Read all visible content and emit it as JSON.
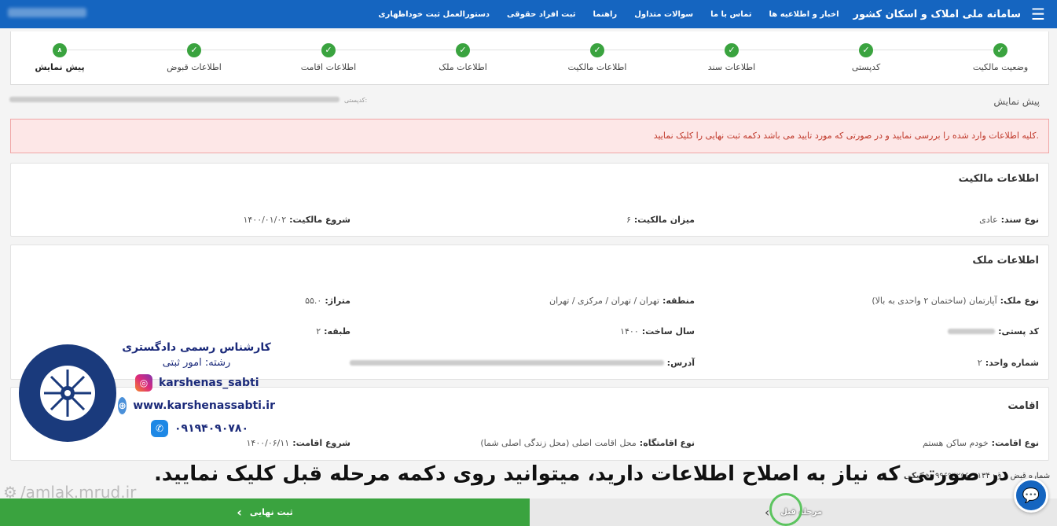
{
  "topbar": {
    "brand": "سامانه ملی املاک و اسکان کشور",
    "nav": [
      "اخبار و اطلاعیه ها",
      "تماس با ما",
      "سوالات متداول",
      "راهنما",
      "ثبت افراد حقوقی",
      "دستورالعمل ثبت خوداظهاری"
    ]
  },
  "steps": [
    {
      "label": "وضعیت مالکیت",
      "mark": "✓"
    },
    {
      "label": "کدپستی",
      "mark": "✓"
    },
    {
      "label": "اطلاعات سند",
      "mark": "✓"
    },
    {
      "label": "اطلاعات مالکیت",
      "mark": "✓"
    },
    {
      "label": "اطلاعات ملک",
      "mark": "✓"
    },
    {
      "label": "اطلاعات اقامت",
      "mark": "✓"
    },
    {
      "label": "اطلاعات قبوض",
      "mark": "✓"
    },
    {
      "label": "پیش نمایش",
      "mark": "۸"
    }
  ],
  "breadcrumb": "پیش نمایش",
  "crumb_meta_label": "کدپستی:",
  "alert": "کلیه اطلاعات وارد شده را بررسی نمایید و در صورتی که مورد تایید می باشد دکمه ثبت نهایی را کلیک نمایید.",
  "ownership": {
    "title": "اطلاعات مالکیت",
    "doc_type_label": "نوع سند:",
    "doc_type": "عادی",
    "share_label": "میزان مالکیت:",
    "share": "۶",
    "start_label": "شروع مالکیت:",
    "start": "۱۴۰۰/۰۱/۰۲"
  },
  "property": {
    "title": "اطلاعات ملک",
    "type_label": "نوع ملک:",
    "type": "آپارتمان (ساختمان ۲ واحدی به بالا)",
    "region_label": "منطقه:",
    "region": "تهران / تهران / مرکزی / تهران",
    "area_label": "متراژ:",
    "area": "۵۵.۰",
    "postal_label": "کد پستی:",
    "year_label": "سال ساخت:",
    "year": "۱۴۰۰",
    "floor_label": "طبقه:",
    "floor": "۲",
    "unit_label": "شماره واحد:",
    "unit": "۲",
    "address_label": "آدرس:"
  },
  "residence": {
    "title": "اقامت",
    "type_label": "نوع اقامت:",
    "type": "خودم ساکن هستم",
    "place_label": "نوع اقامتگاه:",
    "place": "محل اقامت اصلی (محل زندگی اصلی شما)",
    "start_label": "شروع اقامت:",
    "start": "۱۴۰۰/۰۶/۱۱"
  },
  "bill": {
    "label": "شماره قبض برق:",
    "value": "۹۹۶۹۴۲۵۶۰۴۱۳۴",
    "extra": "تفکیکی"
  },
  "promo": {
    "line1": "کارشناس رسمی دادگستری",
    "line2": "رشته: امور ثبتی",
    "instagram": "karshenas_sabti",
    "website": "www.karshenassabti.ir",
    "phone": "۰۹۱۹۴۰۹۰۷۸۰"
  },
  "caption": "در صورتی که نیاز به اصلاح اطلاعات دارید، میتوانید روی دکمه مرحله قبل کلیک نمایید.",
  "watermark": "/amlak.mrud.ir",
  "footer": {
    "submit_label": "ثبت نهایی",
    "prev_label": "مرحله قبل"
  },
  "colors": {
    "primary": "#1565c0",
    "success": "#3aa33f",
    "alert_bg": "#fde7e7",
    "alert_text": "#c0392b"
  }
}
